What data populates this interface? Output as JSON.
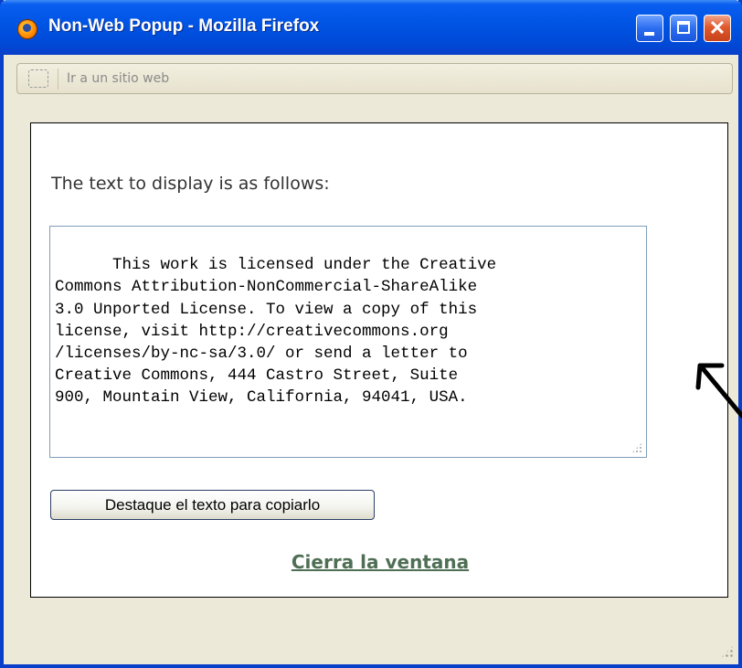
{
  "window": {
    "title": "Non-Web Popup - Mozilla Firefox",
    "buttons": {
      "minimize_icon": "minimize-icon",
      "maximize_icon": "maximize-icon",
      "close_glyph": "✕"
    }
  },
  "urlbar": {
    "placeholder": "Ir a un sitio web",
    "icon": "page-icon"
  },
  "content": {
    "prompt": "The text to display is as follows:",
    "license_text": "This work is licensed under the Creative\nCommons Attribution-NonCommercial-ShareAlike\n3.0 Unported License. To view a copy of this\nlicense, visit http://creativecommons.org\n/licenses/by-nc-sa/3.0/ or send a letter to\nCreative Commons, 444 Castro Street, Suite\n900, Mountain View, California, 94041, USA.",
    "copy_button": "Destaque el texto para copiarlo",
    "close_link": "Cierra la ventana"
  },
  "colors": {
    "titlebar": "#0055e5",
    "link": "#4f6f55",
    "frame": "#ece9d8"
  }
}
